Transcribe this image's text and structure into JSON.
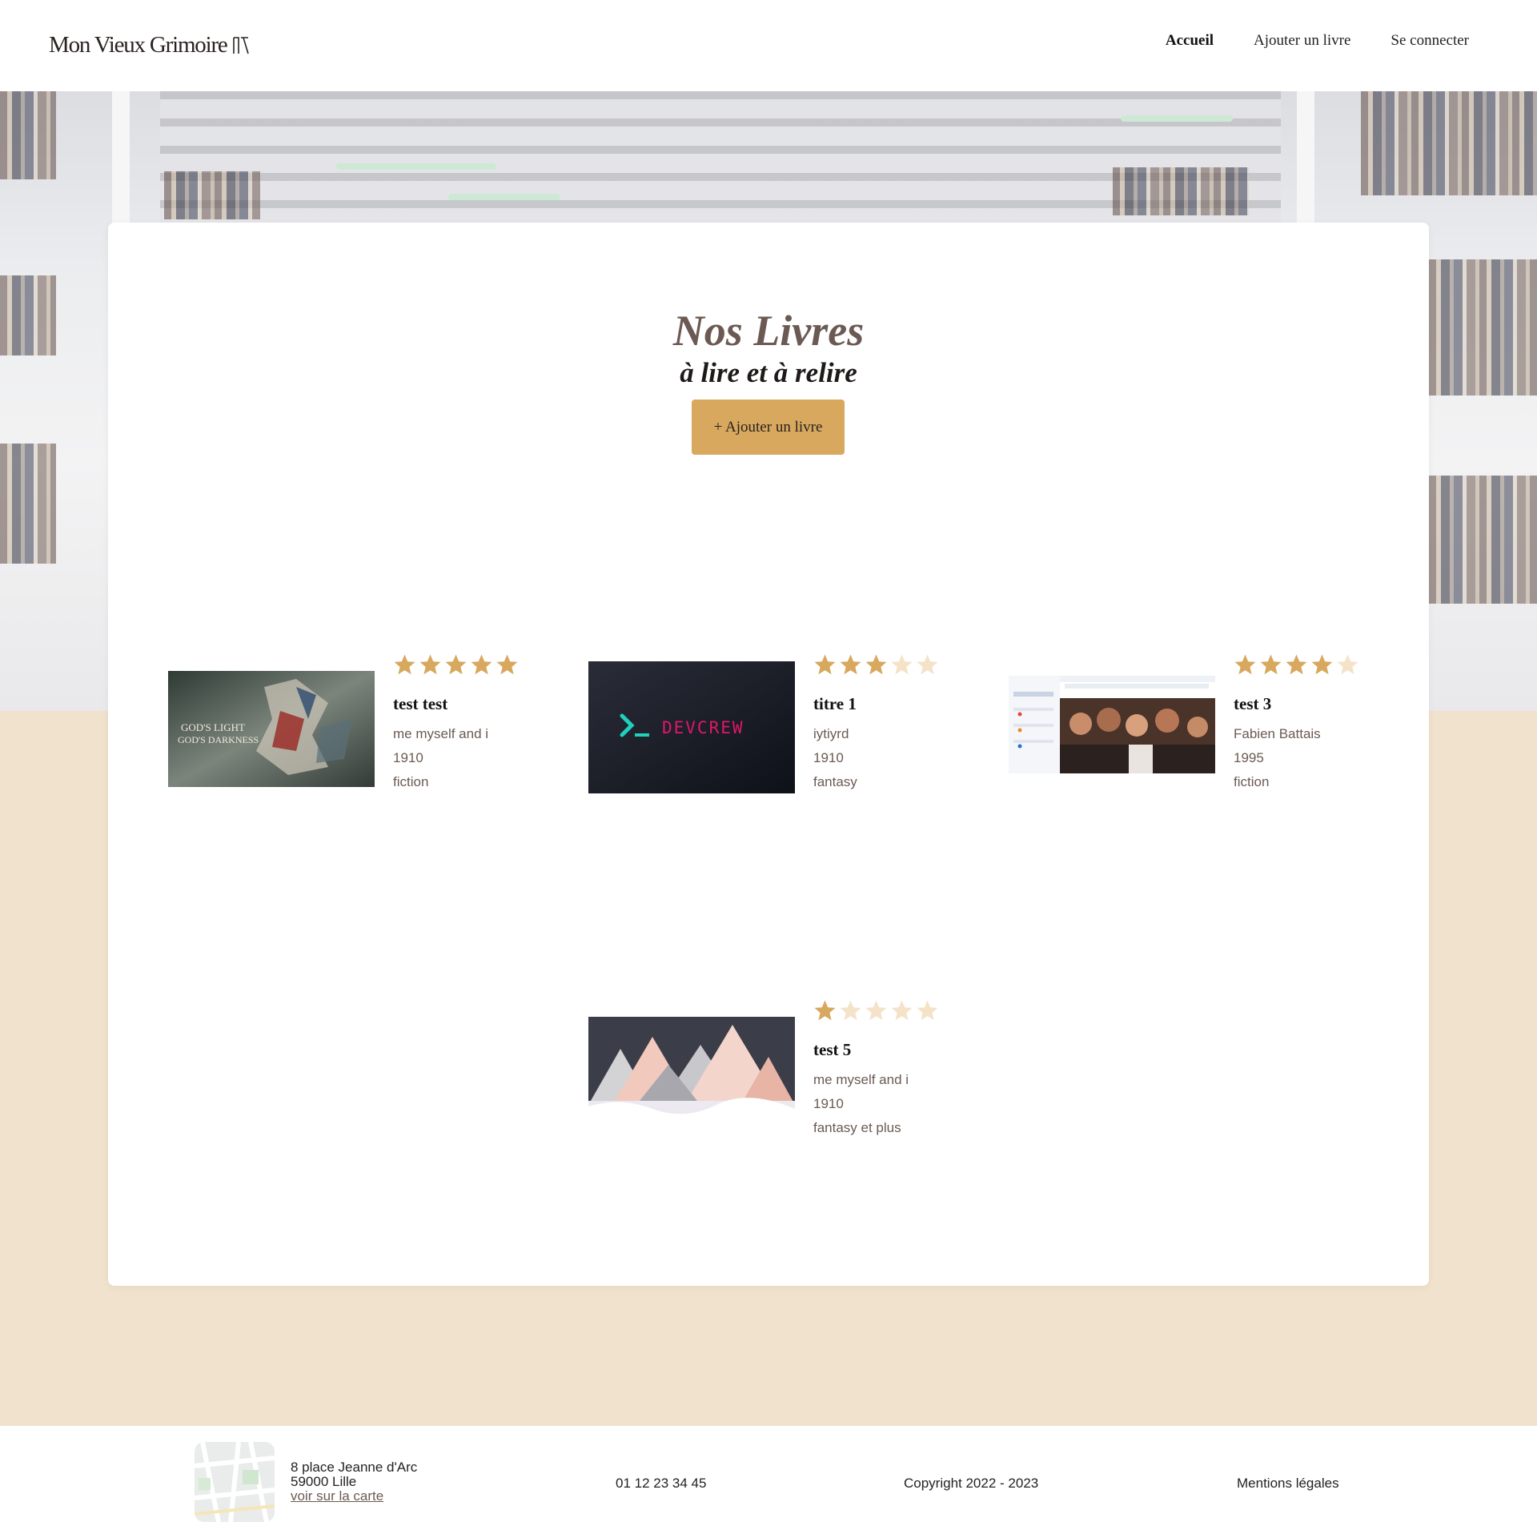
{
  "header": {
    "logo_text": "Mon Vieux Grimoire",
    "nav": [
      {
        "label": "Accueil",
        "active": true
      },
      {
        "label": "Ajouter un livre",
        "active": false
      },
      {
        "label": "Se connecter",
        "active": false
      }
    ]
  },
  "main": {
    "title": "Nos Livres",
    "subtitle": "à lire et à relire",
    "add_button": "+ Ajouter un livre",
    "books": [
      {
        "title": "test test",
        "author": "me myself and i",
        "year": "1910",
        "genre": "fiction",
        "rating": 5,
        "cover": "gods-light-cover-image"
      },
      {
        "title": "titre 1",
        "author": "iytiyrd",
        "year": "1910",
        "genre": "fantasy",
        "rating": 3,
        "cover": "devcrew-cover-image"
      },
      {
        "title": "test 3",
        "author": "Fabien Battais",
        "year": "1995",
        "genre": "fiction",
        "rating": 4,
        "cover": "crowd-screenshot-cover-image"
      },
      {
        "title": "test 5",
        "author": "me myself and i",
        "year": "1910",
        "genre": "fantasy et plus",
        "rating": 1,
        "cover": "mountains-cover-image"
      }
    ],
    "devcrew_logo_text": "DEVCREW"
  },
  "footer": {
    "address_line1": "8 place Jeanne d'Arc",
    "address_line2": "59000 Lille",
    "map_link": "voir sur la carte",
    "phone": "01 12 23 34 45",
    "copyright": "Copyright 2022 - 2023",
    "legal": "Mentions légales"
  },
  "colors": {
    "accent": "#d7a85e",
    "star_empty": "#f4e3c9",
    "page_bg": "#f0e2cd",
    "muted_text": "#6b5a53"
  }
}
